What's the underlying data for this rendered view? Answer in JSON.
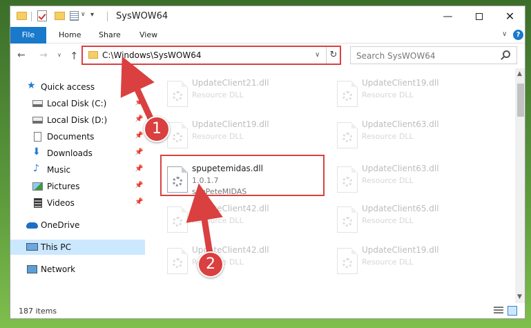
{
  "window": {
    "title": "SysWOW64",
    "min_glyph": "—",
    "close_glyph": "✕"
  },
  "ribbon": {
    "tabs": [
      "File",
      "Home",
      "Share",
      "View"
    ],
    "chevron": "∨",
    "help": "?"
  },
  "navbar": {
    "back": "←",
    "forward": "→",
    "recent": "∨",
    "up": "↑",
    "address": "C:\\Windows\\SysWOW64",
    "address_drop": "∨",
    "refresh": "↻",
    "search_placeholder": "Search SysWOW64"
  },
  "sidebar": {
    "pin": "📌",
    "items": [
      {
        "label": "Quick access",
        "glyph": "★"
      },
      {
        "label": "Local Disk (C:)"
      },
      {
        "label": "Local Disk (D:)"
      },
      {
        "label": "Documents"
      },
      {
        "label": "Downloads",
        "glyph": "⬇"
      },
      {
        "label": "Music",
        "glyph": "♪"
      },
      {
        "label": "Pictures"
      },
      {
        "label": "Videos"
      },
      {
        "label": "OneDrive"
      },
      {
        "label": "This PC"
      },
      {
        "label": "Network"
      }
    ]
  },
  "files": [
    {
      "name": "UpdateClient21.dll",
      "line1": "Resource DLL",
      "line2": ""
    },
    {
      "name": "UpdateClient19.dll",
      "line1": "Resource DLL",
      "line2": ""
    },
    {
      "name": "UpdateClient19.dll",
      "line1": "Resource DLL",
      "line2": ""
    },
    {
      "name": "UpdateClient63.dll",
      "line1": "Resource DLL",
      "line2": ""
    },
    {
      "name": "spupetemidas.dll",
      "line1": "1.0.1.7",
      "line2": "spuPeteMIDAS"
    },
    {
      "name": "UpdateClient63.dll",
      "line1": "Resource DLL",
      "line2": ""
    },
    {
      "name": "UpdateClient42.dll",
      "line1": "Resource DLL",
      "line2": ""
    },
    {
      "name": "UpdateClient65.dll",
      "line1": "Resource DLL",
      "line2": ""
    },
    {
      "name": "UpdateClient42.dll",
      "line1": "Resource DLL",
      "line2": ""
    },
    {
      "name": "UpdateClient19.dll",
      "line1": "Resource DLL",
      "line2": ""
    }
  ],
  "scroll": {
    "up": "▲",
    "down": "▼"
  },
  "status": {
    "items": "187 items"
  },
  "annotations": {
    "step1": "1",
    "step2": "2",
    "color": "#d94040"
  }
}
